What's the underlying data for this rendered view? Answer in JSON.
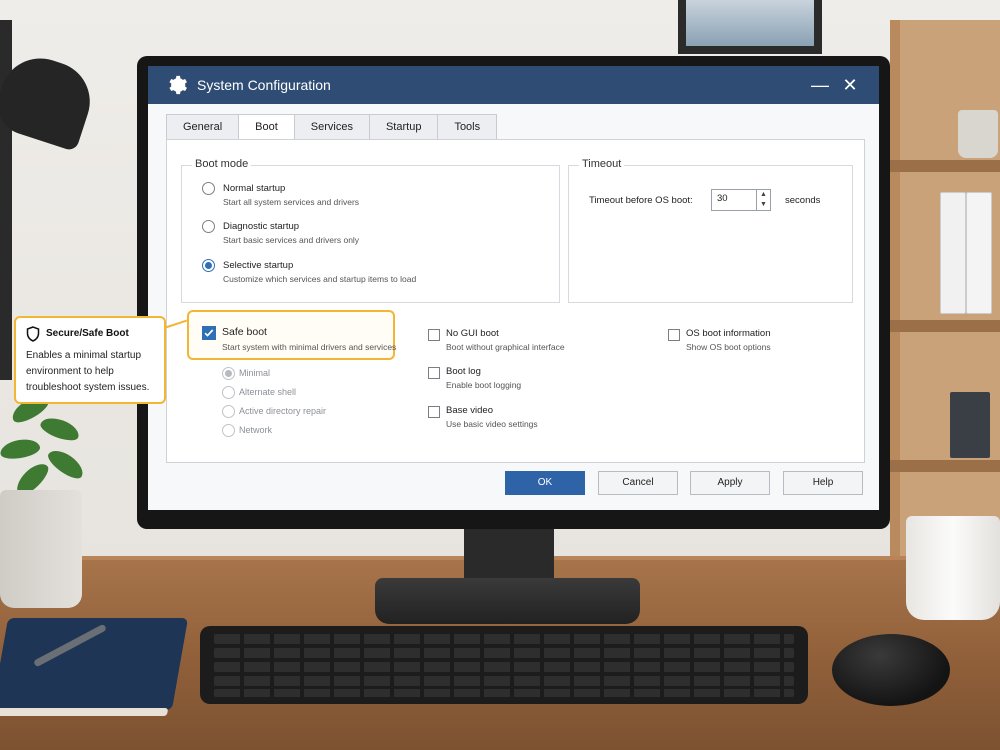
{
  "window": {
    "title": "System Configuration",
    "minimize_glyph": "—",
    "close_glyph": "✕"
  },
  "tabs": [
    {
      "label": "General",
      "active": false
    },
    {
      "label": "Boot",
      "active": true
    },
    {
      "label": "Services",
      "active": false
    },
    {
      "label": "Startup",
      "active": false
    },
    {
      "label": "Tools",
      "active": false
    }
  ],
  "boot_mode": {
    "title": "Boot mode",
    "options": [
      {
        "label": "Normal startup",
        "description": "Start all system services and drivers",
        "selected": false
      },
      {
        "label": "Diagnostic startup",
        "description": "Start basic services and drivers only",
        "selected": false
      },
      {
        "label": "Selective startup",
        "description": "Customize which services and startup items to load",
        "selected": true
      }
    ]
  },
  "timeout": {
    "title": "Timeout",
    "label": "Timeout before OS boot:",
    "value": "30",
    "unit": "seconds"
  },
  "safe_boot": {
    "label": "Safe boot",
    "description": "Start system with minimal drivers and services",
    "checked": true,
    "sub_options": [
      {
        "label": "Minimal",
        "selected": true
      },
      {
        "label": "Alternate shell",
        "selected": false
      },
      {
        "label": "Active directory repair",
        "selected": false
      },
      {
        "label": "Network",
        "selected": false
      }
    ]
  },
  "boot_options": [
    {
      "label": "No GUI boot",
      "description": "Boot without graphical interface",
      "checked": false
    },
    {
      "label": "Boot log",
      "description": "Enable boot logging",
      "checked": false
    },
    {
      "label": "Base video",
      "description": "Use basic video settings",
      "checked": false
    },
    {
      "label": "OS boot information",
      "description": "Show OS boot options",
      "checked": false
    }
  ],
  "buttons": {
    "ok": "OK",
    "cancel": "Cancel",
    "apply": "Apply",
    "help": "Help"
  },
  "callout": {
    "title": "Secure/Safe Boot",
    "text": "Enables a minimal startup environment to help troubleshoot system issues."
  },
  "colors": {
    "titlebar": "#2f4d74",
    "accent": "#2f6fb5",
    "highlight": "#f2b632"
  }
}
